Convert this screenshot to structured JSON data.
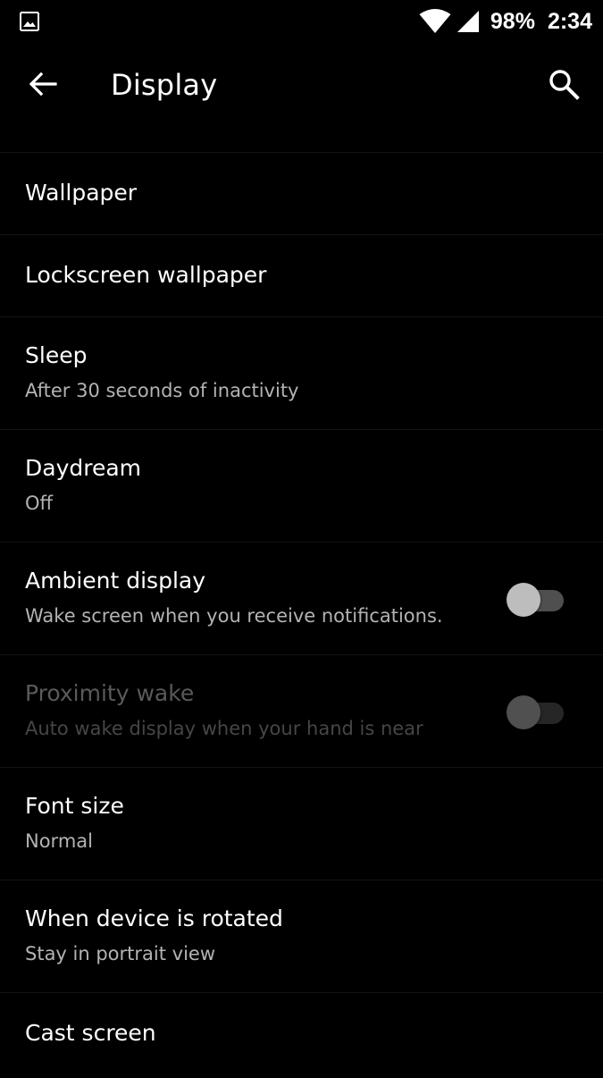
{
  "status_bar": {
    "notification_icon": "image-icon",
    "wifi_icon": "wifi-icon",
    "signal_icon": "cell-signal-icon",
    "battery": "98%",
    "time": "2:34"
  },
  "app_bar": {
    "back_icon": "arrow-back-icon",
    "title": "Display",
    "search_icon": "search-icon"
  },
  "settings": [
    {
      "title": "Wallpaper"
    },
    {
      "title": "Lockscreen wallpaper"
    },
    {
      "title": "Sleep",
      "summary": "After 30 seconds of inactivity"
    },
    {
      "title": "Daydream",
      "summary": "Off"
    },
    {
      "title": "Ambient display",
      "summary": "Wake screen when you receive notifications.",
      "toggle": "off"
    },
    {
      "title": "Proximity wake",
      "summary": "Auto wake display when your hand is near",
      "toggle": "off",
      "disabled": true
    },
    {
      "title": "Font size",
      "summary": "Normal"
    },
    {
      "title": "When device is rotated",
      "summary": "Stay in portrait view"
    },
    {
      "title": "Cast screen"
    }
  ],
  "colors": {
    "background": "#000000",
    "text_primary": "#ffffff",
    "text_secondary": "#b3b3b3",
    "text_disabled": "#5a5a5a"
  }
}
